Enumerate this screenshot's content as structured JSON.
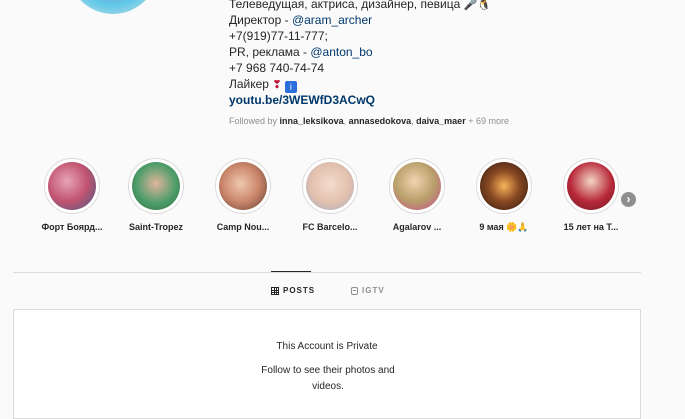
{
  "profile": {
    "bio_lines": [
      {
        "text": "Телеведущая, актриса, дизайнер, певица",
        "emoji": "🎤🐧"
      },
      {
        "prefix": "Директор - ",
        "link": "@aram_archer"
      },
      {
        "text": "+7(919)77-11-777;"
      },
      {
        "prefix": "PR, реклама - ",
        "link": "@anton_bo"
      },
      {
        "text": "+7 968 740-74-74"
      },
      {
        "text": "Лайкер",
        "emoji": "❣",
        "emoji2": "i"
      },
      {
        "site": "youtu.be/3WEWfD3ACwQ"
      }
    ],
    "followed_by": {
      "prefix": "Followed by",
      "users": [
        "inna_leksikova",
        "annasedokova",
        "daiva_maer"
      ],
      "more": "+ 69 more"
    }
  },
  "highlights": [
    {
      "label": "Форт Боярд...",
      "color": "#c2536f"
    },
    {
      "label": "Saint-Tropez",
      "color": "#4f9d6b"
    },
    {
      "label": "Camp Nou...",
      "color": "#c9856a"
    },
    {
      "label": "FC Barcelo...",
      "color": "#e2c0ad"
    },
    {
      "label": "Agalarov ...",
      "color": "#b8a06b"
    },
    {
      "label": "9 мая 🌼🙏",
      "color": "#4a2a1a"
    },
    {
      "label": "15 лет на Т...",
      "color": "#b8283a"
    }
  ],
  "tabs": {
    "posts": "POSTS",
    "igtv": "IGTV"
  },
  "private": {
    "title": "This Account is Private",
    "subtitle": "Follow to see their photos and videos."
  },
  "icons": {
    "next": "chevron-right-icon",
    "posts": "grid-icon",
    "igtv": "igtv-icon"
  }
}
